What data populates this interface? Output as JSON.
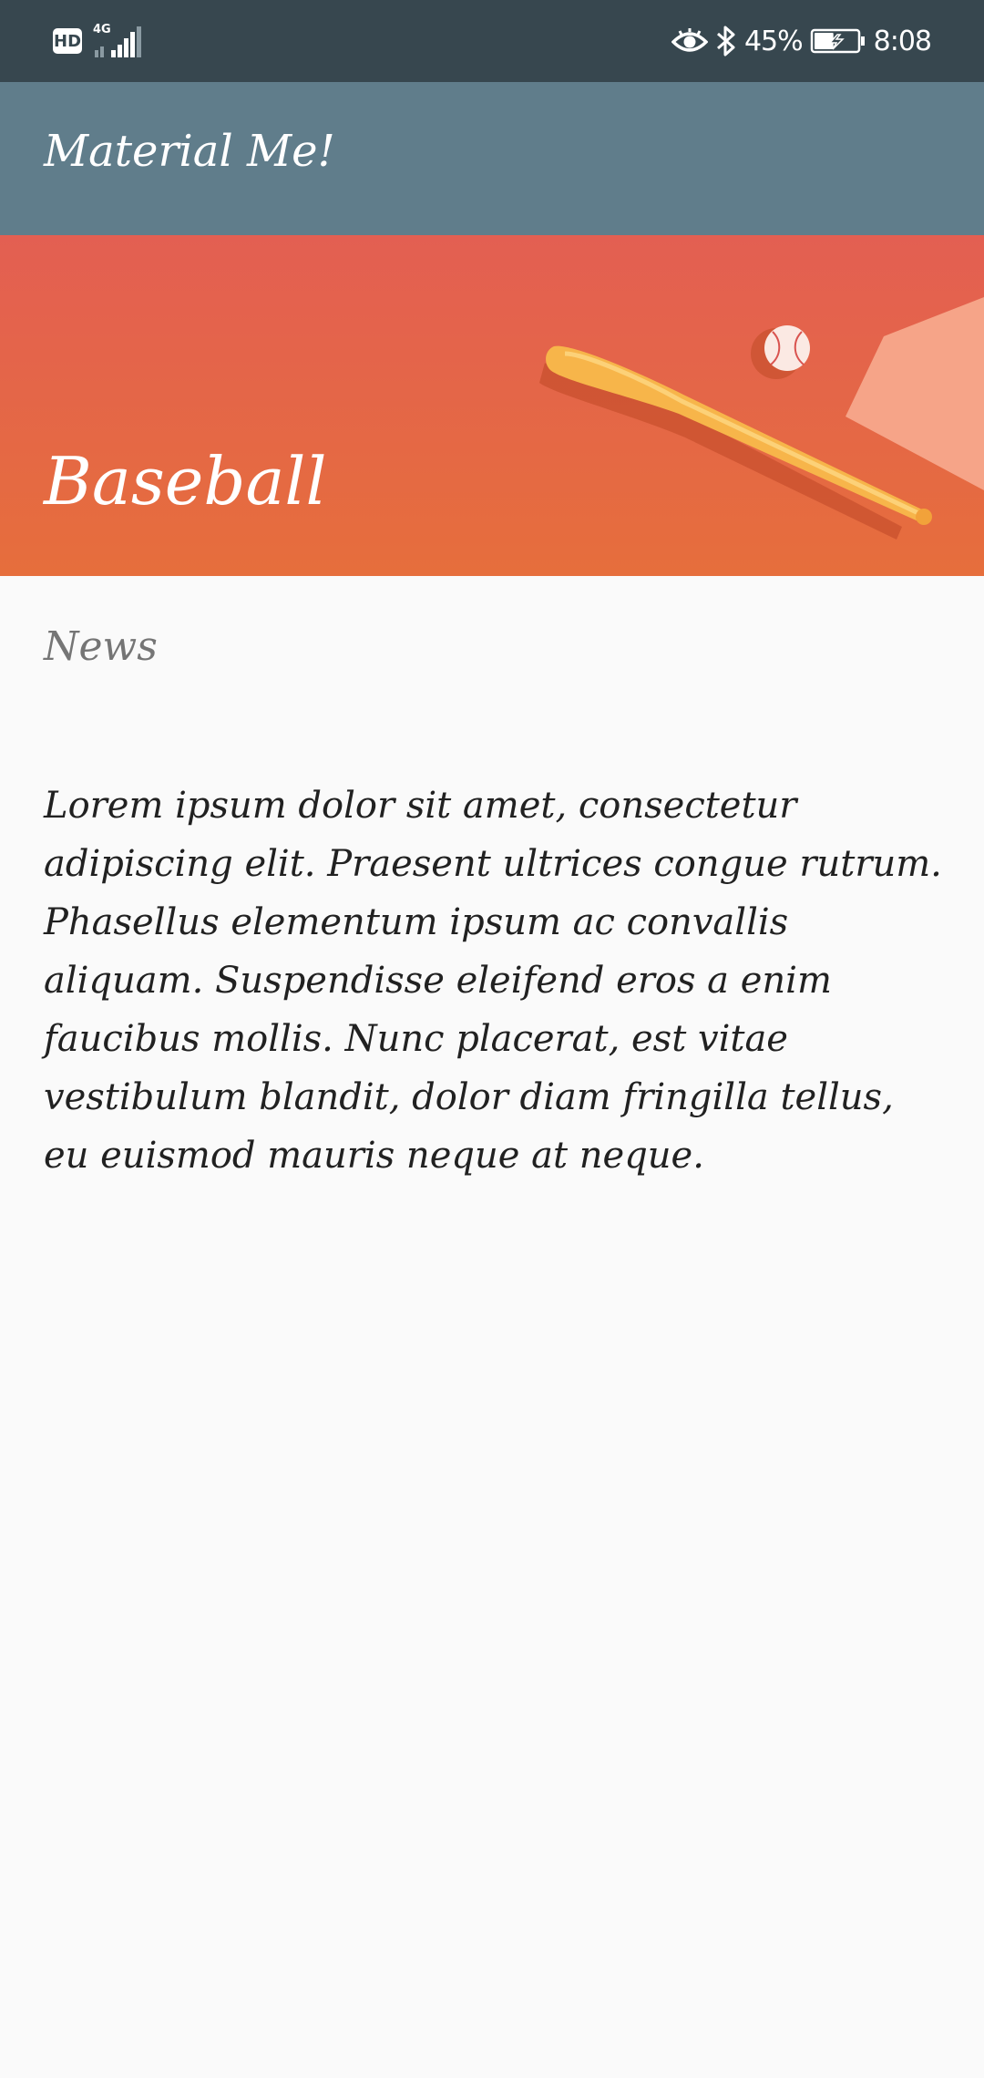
{
  "status_bar": {
    "hd_label": "HD",
    "network_label": "4G",
    "battery_percent": "45%",
    "battery_level": 0.45,
    "time": "8:08",
    "icons": [
      "hd-icon",
      "signal-icon",
      "eye-icon",
      "bluetooth-icon",
      "battery-charging-icon"
    ]
  },
  "app_bar": {
    "title": "Material Me!",
    "color": "#607d8b"
  },
  "card": {
    "banner_title": "Baseball",
    "banner_image": "baseball-bat-image",
    "subtitle": "News",
    "body": "Lorem ipsum dolor sit amet, consectetur adipiscing elit. Praesent ultrices congue rutrum. Phasellus elementum ipsum ac convallis aliquam. Suspendisse eleifend eros a enim faucibus mollis. Nunc placerat, est vitae vestibulum blandit, dolor diam fringilla tellus, eu euismod mauris neque at neque."
  },
  "colors": {
    "status_bar": "#37474f",
    "banner_top": "#e35f52",
    "banner_bottom": "#e66e3c",
    "background": "#fafafa"
  }
}
